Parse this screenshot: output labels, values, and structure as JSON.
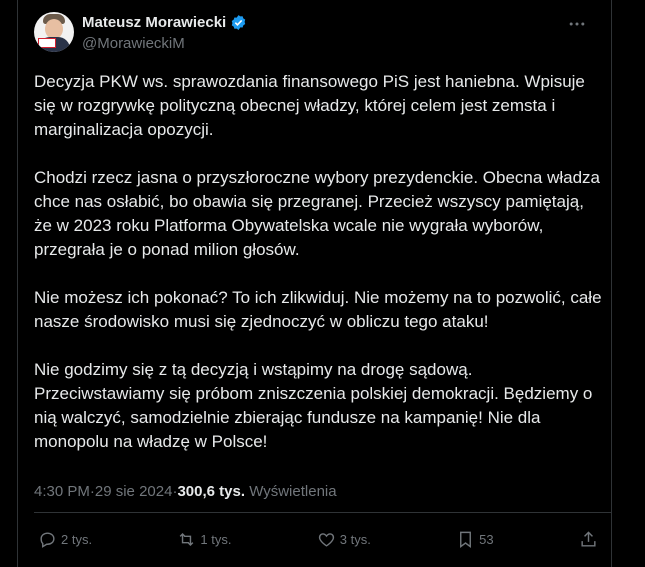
{
  "author": {
    "name": "Mateusz Morawiecki",
    "handle": "@MorawieckiM"
  },
  "tweet": {
    "paragraphs": [
      "Decyzja PKW ws. sprawozdania finansowego PiS jest haniebna. Wpisuje się w rozgrywkę polityczną obecnej władzy, której celem jest zemsta i marginalizacja opozycji.",
      "Chodzi rzecz jasna o przyszłoroczne wybory prezydenckie. Obecna władza chce nas osłabić, bo obawia się przegranej. Przecież wszyscy pamiętają, że w 2023 roku Platforma Obywatelska wcale nie wygrała wyborów, przegrała je o ponad milion głosów.",
      "Nie możesz ich pokonać? To ich zlikwiduj. Nie możemy na to pozwolić, całe nasze środowisko musi się zjednoczyć w obliczu tego ataku!",
      "Nie godzimy się z tą decyzją i wstąpimy na drogę sądową. Przeciwstawiamy się próbom zniszczenia polskiej demokracji. Będziemy o nią walczyć, samodzielnie zbierając fundusze na kampanię! Nie dla monopolu na władzę w Polsce!"
    ],
    "time": "4:30 PM",
    "separator": " · ",
    "date": "29 sie 2024",
    "views_count": "300,6 tys.",
    "views_label": "Wyświetlenia"
  },
  "actions": {
    "replies": "2 tys.",
    "reposts": "1 tys.",
    "likes": "3 tys.",
    "bookmarks": "53"
  },
  "colors": {
    "background": "#000000",
    "text": "#e7e9ea",
    "muted": "#71767b",
    "accent": "#1d9bf0"
  },
  "icons": {
    "verified": "verified-badge-icon",
    "more": "more-icon",
    "reply": "reply-icon",
    "repost": "repost-icon",
    "like": "heart-icon",
    "bookmark": "bookmark-icon",
    "share": "share-icon"
  }
}
